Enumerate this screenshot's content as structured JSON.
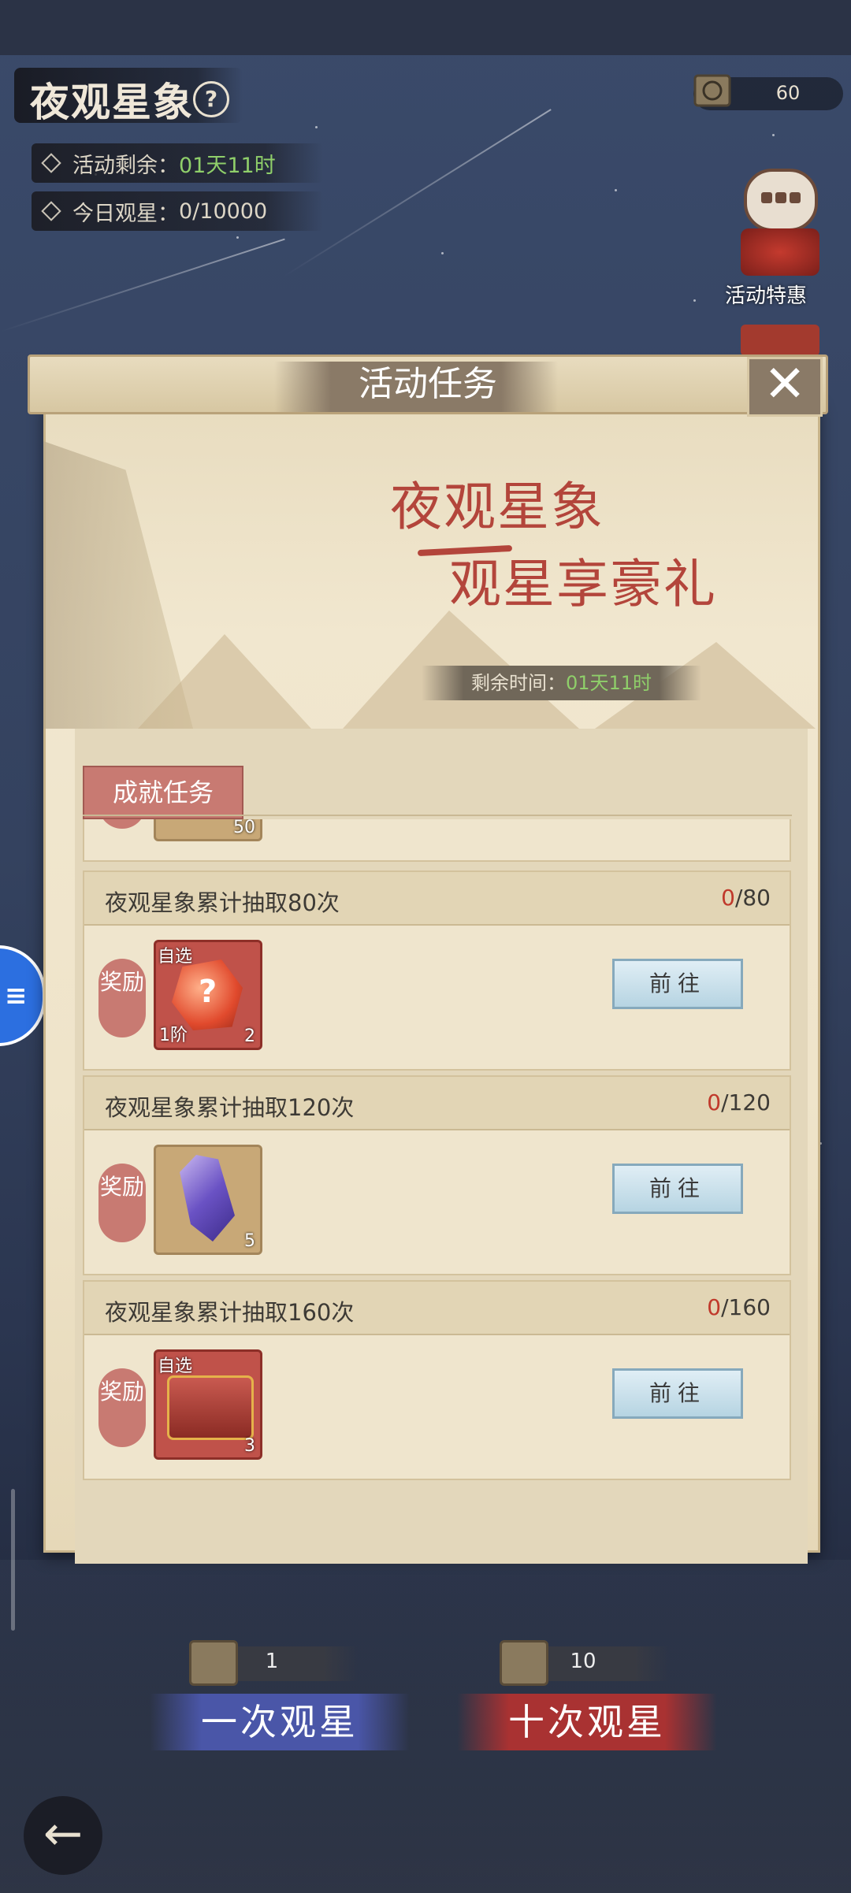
{
  "header": {
    "title": "夜观星象",
    "remaining_label": "活动剩余：",
    "remaining_value": "01天11时",
    "today_label": "今日观星：",
    "today_value": "0/10000"
  },
  "currency": {
    "value": "60"
  },
  "side": {
    "special_label": "活动特惠"
  },
  "modal": {
    "title": "活动任务",
    "banner_line1": "夜观星象",
    "banner_line2": "观星享豪礼",
    "timer_label": "剩余时间：",
    "timer_value": "01天11时",
    "tab": "成就任务",
    "reward_label": "奖励",
    "go_label": "前往",
    "partial_item_qty": "50",
    "tasks": [
      {
        "name": "夜观星象累计抽取80次",
        "current": "0",
        "total": "/80",
        "item": "red-gem",
        "choose": "自选",
        "tier": "1阶",
        "qty": "2"
      },
      {
        "name": "夜观星象累计抽取120次",
        "current": "0",
        "total": "/120",
        "item": "purple-crystal",
        "qty": "5"
      },
      {
        "name": "夜观星象累计抽取160次",
        "current": "0",
        "total": "/160",
        "item": "red-chest",
        "choose": "自选",
        "qty": "3"
      }
    ]
  },
  "bottom": {
    "cost_one": "1",
    "cost_ten": "10",
    "draw_one": "一次观星",
    "draw_ten": "十次观星"
  }
}
